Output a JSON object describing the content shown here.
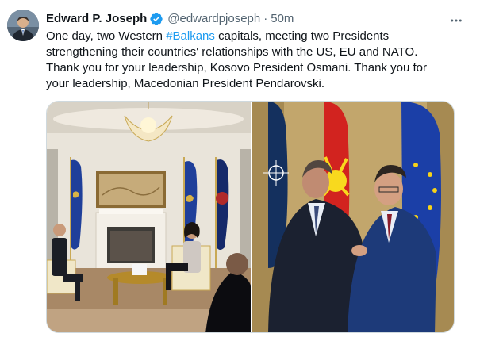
{
  "author": {
    "name": "Edward P. Joseph",
    "handle": "@edwardpjoseph",
    "separator": "·",
    "time": "50m"
  },
  "body": {
    "part1": "One day, two Western ",
    "hashtag": "#Balkans",
    "part2": " capitals, meeting two Presidents strengthening their countries' relationships with the US, EU and NATO. Thank you for your leadership, Kosovo President Osmani. Thank you for your leadership, Macedonian President Pendarovski."
  },
  "icons": {
    "verified": "verified-badge-icon",
    "more": "more-options-icon"
  },
  "colors": {
    "link": "#1d9bf0",
    "verified": "#1d9bf0",
    "secondary_text": "#536471",
    "border": "#cfd9de"
  }
}
